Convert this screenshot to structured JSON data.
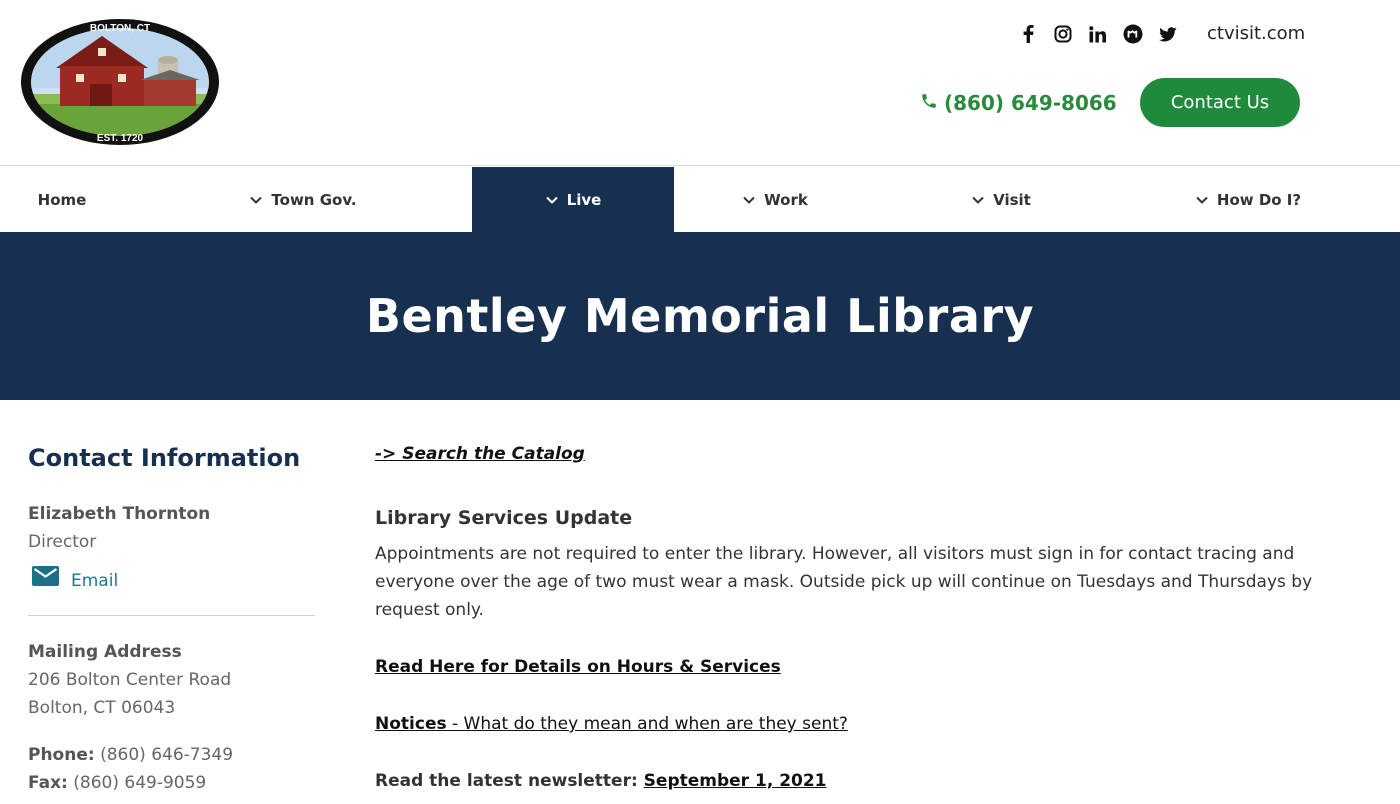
{
  "header": {
    "logo": {
      "top_text": "BOLTON, CT",
      "bottom_text": "EST. 1720"
    },
    "social": [
      {
        "name": "facebook-icon"
      },
      {
        "name": "instagram-icon"
      },
      {
        "name": "linkedin-icon"
      },
      {
        "name": "meetup-icon"
      },
      {
        "name": "twitter-icon"
      }
    ],
    "ctvisit": "ctvisit.com",
    "phone": "(860) 649-8066",
    "contact_button": "Contact Us",
    "accent_color": "#1f8a3c"
  },
  "nav": {
    "items": [
      {
        "label": "Home",
        "has_chevron": false
      },
      {
        "label": "Town Gov.",
        "has_chevron": true
      },
      {
        "label": "Live",
        "has_chevron": true,
        "active": true
      },
      {
        "label": "Work",
        "has_chevron": true
      },
      {
        "label": "Visit",
        "has_chevron": true
      },
      {
        "label": "How Do I?",
        "has_chevron": true
      }
    ],
    "active_color": "#18304f"
  },
  "banner": {
    "title": "Bentley Memorial Library",
    "bg_color": "#18304f"
  },
  "sidebar": {
    "heading": "Contact Information",
    "person_name": "Elizabeth Thornton",
    "person_title": "Director",
    "email_label": "Email",
    "mailing_label": "Mailing Address",
    "address_line1": "206 Bolton Center Road",
    "address_line2": "Bolton, CT 06043",
    "phone_label": "Phone:",
    "phone_value": "(860) 646-7349",
    "fax_label": "Fax:",
    "fax_value": "(860) 649-9059"
  },
  "main": {
    "catalog_link": "-> Search the Catalog",
    "update_title": "Library Services Update",
    "update_text": "Appointments are not required to enter the library. However, all visitors must sign in for contact tracing and everyone over the age of two must wear a mask. Outside pick up will continue on Tuesdays and Thursdays by request only.",
    "details_link": "Read Here for Details on Hours & Services",
    "notices_strong": "Notices",
    "notices_rest": " - What do they mean and when are they sent?",
    "newsletter_label": "Read the latest newsletter: ",
    "newsletter_link": "September 1, 2021"
  }
}
